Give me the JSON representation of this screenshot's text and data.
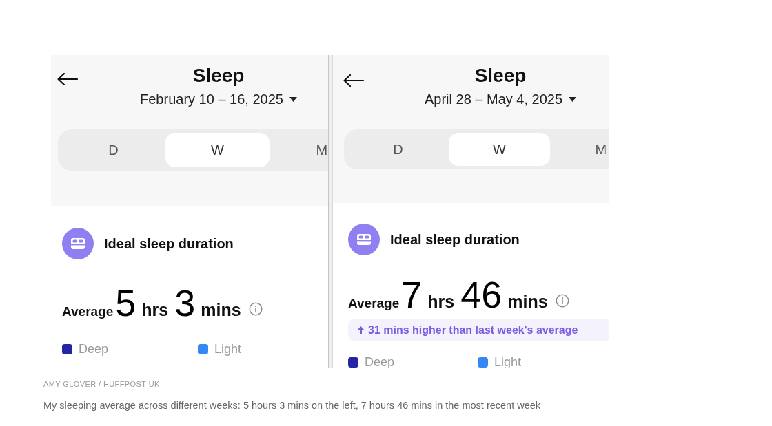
{
  "screens": [
    {
      "title": "Sleep",
      "date_range": "February 10 – 16, 2025",
      "tabs": [
        {
          "label": "D",
          "selected": false
        },
        {
          "label": "W",
          "selected": true
        },
        {
          "label": "M",
          "selected": false
        }
      ],
      "card": {
        "title": "Ideal sleep duration",
        "average_label": "Average",
        "hours": "5",
        "hours_unit": "hrs",
        "minutes": "3",
        "minutes_unit": "mins"
      },
      "legend": [
        {
          "label": "Deep",
          "color": "#2424a6"
        },
        {
          "label": "Light",
          "color": "#3388f4"
        }
      ]
    },
    {
      "title": "Sleep",
      "date_range": "April 28 – May 4, 2025",
      "tabs": [
        {
          "label": "D",
          "selected": false
        },
        {
          "label": "W",
          "selected": true
        },
        {
          "label": "M",
          "selected": false
        }
      ],
      "card": {
        "title": "Ideal sleep duration",
        "average_label": "Average",
        "hours": "7",
        "hours_unit": "hrs",
        "minutes": "46",
        "minutes_unit": "mins",
        "comparison": "31 mins higher than last week's average"
      },
      "legend": [
        {
          "label": "Deep",
          "color": "#2424a6"
        },
        {
          "label": "Light",
          "color": "#3388f4"
        }
      ]
    }
  ],
  "photo_credit": "AMY GLOVER / HUFFPOST UK",
  "caption": "My sleeping average across different weeks: 5 hours 3 mins on the left, 7 hours 46 mins in the most recent week"
}
